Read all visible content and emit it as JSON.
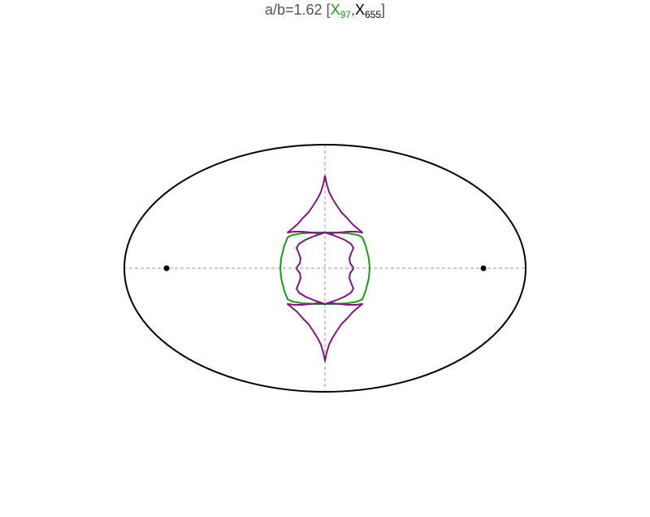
{
  "title": {
    "prefix": "a/b=1.62 [",
    "x1_letter": "X",
    "x1_sub": "97",
    "comma": ",",
    "x2_letter": "X",
    "x2_sub": "655",
    "suffix": "]"
  },
  "colors": {
    "ellipse": "#000000",
    "axes": "#999999",
    "curve_x97": "#1a9a1a",
    "curve_x655": "#7b1a7b",
    "title_text": "#555555",
    "title_x97": "#1a9a1a",
    "title_x655": "#000000"
  },
  "ellipse": {
    "a": 1.62,
    "b": 1
  },
  "foci": [
    [
      -1.277,
      0
    ],
    [
      1.277,
      0
    ]
  ],
  "curves": {
    "x97": {
      "name": "X97"
    },
    "x655": {
      "name": "X655"
    }
  }
}
